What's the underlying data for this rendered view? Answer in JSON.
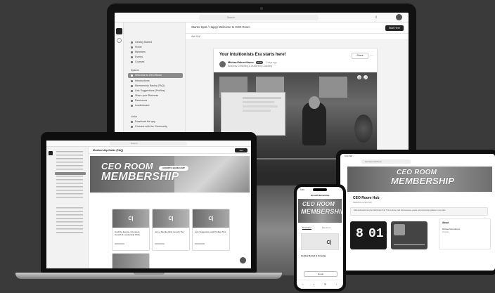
{
  "imac": {
    "search_label": "Search",
    "breadcrumb": "Starter Spot / Happy Welcome to CEO Room",
    "back_label": "Ask Out",
    "sidebar_items": [
      "Getting Started",
      "Home",
      "Members",
      "Events",
      "Courses"
    ],
    "sidebar_section_label": "Spaces",
    "sidebar_space_items": [
      "Welcome to CEO Room",
      "Introductions",
      "Membership Basics (FAQ)",
      "Link Suggestions (Profiles)",
      "Share your Business",
      "Resources",
      "Leaderboard"
    ],
    "sidebar_section2_label": "Links",
    "sidebar_link_items": [
      "Download the app",
      "Connect with the Community"
    ],
    "post_title": "Your Intuitionists Era starts here!",
    "author_name": "Michael Morrelliners",
    "author_badge": "Host",
    "author_time": "2 days ago",
    "author_subtitle": "Business Consulting & Leadership Coaching",
    "follow_label": "Share",
    "button_label": "Start Here"
  },
  "macbook": {
    "search_label": "Search",
    "breadcrumb": "Membership Guide (FAQ)",
    "button_label": "Join",
    "banner_line1": "CEO ROOM",
    "banner_line2": "MEMBERSHIP",
    "banner_pill": "GROWTH BASECAMP",
    "card_texts": [
      "How the Events, Founders, Growth & Leadership Work",
      "Join a Membership Growth Tier",
      "Link Suggestion and Profiles Tips"
    ]
  },
  "ipad": {
    "time": "9:41 AM",
    "url_label": "ceoroom.circle.so",
    "banner_line1": "CEO ROOM",
    "banner_line2": "MEMBERSHIP",
    "hub_title": "CEO Room Hub",
    "hub_subtitle": "Welcome to the hub",
    "notice_text": "Hello and welcome to the CEO Room Hub. This is where you'll find resources, events, and community updates in one place.",
    "clock_digits": [
      "8",
      "01"
    ],
    "profile_label": "About",
    "profile_name": "Michael Morrelliners",
    "profile_role": "Founder"
  },
  "iphone": {
    "time": "9:41",
    "header_label": "Growth Basecamp",
    "banner_line1": "CEO ROOM",
    "banner_line2": "MEMBERSHIP",
    "tabs": [
      "Overview",
      "Members"
    ],
    "item_label": "Getting Started & Growing",
    "button_label": "Enroll"
  }
}
